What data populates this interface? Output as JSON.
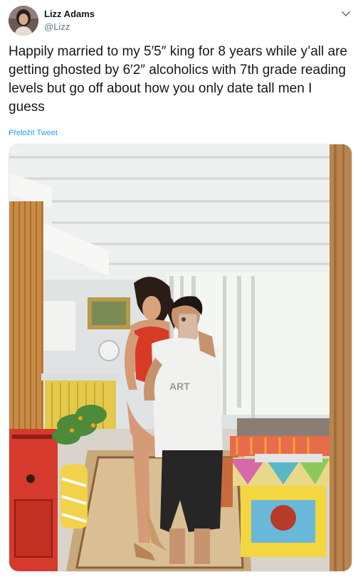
{
  "tweet": {
    "author_name": "Lizz Adams",
    "author_handle": "@Lizz",
    "text": "Happily married to my 5′5″ king for 8 years while y’all are getting ghosted by 6′2″ alcoholics with 7th grade reading levels but go off about how you only date tall men I guess",
    "translate_label": "Přeložit Tweet"
  },
  "media": {
    "shirt_text": "ART"
  },
  "icons": {
    "menu": "chevron-down-icon"
  },
  "colors": {
    "link": "#1da1f2",
    "secondary_text": "#657786",
    "primary_text": "#14171a"
  }
}
